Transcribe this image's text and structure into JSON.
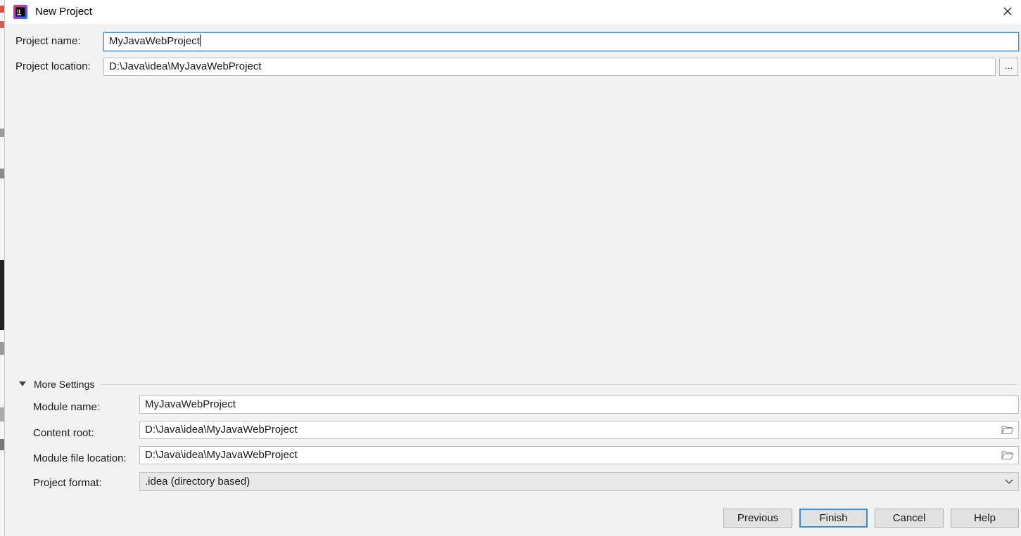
{
  "window": {
    "title": "New Project",
    "close_icon": "close-icon",
    "app_icon": "intellij-idea-icon"
  },
  "project": {
    "name_label": "Project name:",
    "name_value": "MyJavaWebProject",
    "location_label": "Project location:",
    "location_value": "D:\\Java\\idea\\MyJavaWebProject",
    "browse_label": "..."
  },
  "more_settings": {
    "label": "More Settings",
    "module_name_label": "Module name:",
    "module_name_value": "MyJavaWebProject",
    "content_root_label": "Content root:",
    "content_root_value": "D:\\Java\\idea\\MyJavaWebProject",
    "module_file_label": "Module file location:",
    "module_file_value": "D:\\Java\\idea\\MyJavaWebProject",
    "project_format_label": "Project format:",
    "project_format_value": ".idea (directory based)"
  },
  "buttons": {
    "previous": "Previous",
    "finish": "Finish",
    "cancel": "Cancel",
    "help": "Help"
  },
  "colors": {
    "focus": "#3a8fd6",
    "dialog_bg": "#f2f2f2",
    "field_bg": "#ffffff"
  }
}
